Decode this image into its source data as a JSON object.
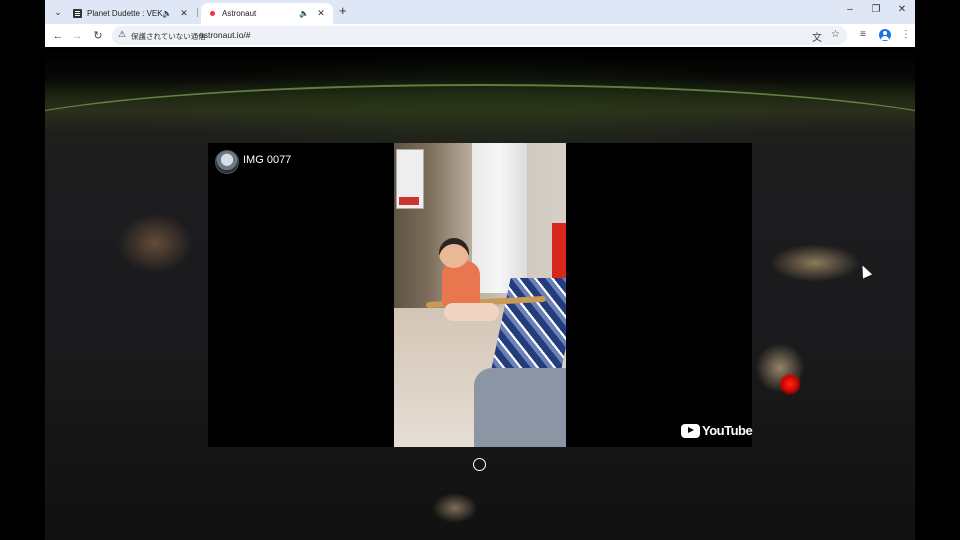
{
  "browser": {
    "tabs": [
      {
        "title": "Planet Dudette : VEKTROID",
        "favicon": "document-icon",
        "audio": "speaker-icon",
        "active": false
      },
      {
        "title": "Astronaut",
        "favicon": "red-dot-icon",
        "audio": "speaker-icon",
        "active": true
      }
    ],
    "address_bar": {
      "security_text": "保護されていない通信",
      "url": "astronaut.io/#"
    }
  },
  "video": {
    "title": "IMG 0077",
    "brand": "YouTube"
  },
  "colors": {
    "tabstrip_bg": "#dfe6f5",
    "omnibox_bg": "#eef1f8",
    "accent_red": "#ff2a1a",
    "profile_blue": "#1a73e8"
  }
}
